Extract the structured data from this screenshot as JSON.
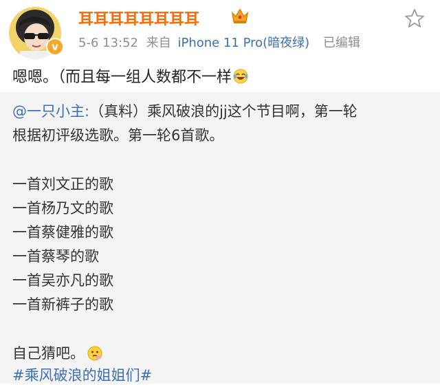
{
  "header": {
    "user_name": "耳耳耳耳耳耳耳耳",
    "avatar_badge": "v",
    "timestamp": "5-6 13:52",
    "source_prefix": "来自",
    "device": "iPhone 11 Pro(暗夜绿)",
    "edited": "已编辑"
  },
  "post": {
    "text": "嗯嗯。（而且每一组人数都不一样"
  },
  "repost": {
    "mention": "@一只小主:",
    "line1_rest": "（真料）乘风破浪的jj这个节目啊，第一轮",
    "line2": "根据初评级选歌。第一轮6首歌。",
    "songs": [
      "一首刘文正的歌",
      "一首杨乃文的歌",
      "一首蔡健雅的歌",
      "一首蔡琴的歌",
      "一首吴亦凡的歌",
      "一首新裤子的歌"
    ],
    "closing": "自己猜吧。",
    "hashtag": "#乘风破浪的姐姐们#"
  },
  "colors": {
    "name": "#f66b08",
    "link": "#3b6fb7",
    "meta": "#8e8e8e",
    "repost_bg": "#f4f4f4"
  },
  "icons": [
    "avatar",
    "verified-badge-icon",
    "crown-vip-icon",
    "favorite-star-icon",
    "laugh-cry-emoji-icon",
    "thinking-emoji-icon"
  ]
}
